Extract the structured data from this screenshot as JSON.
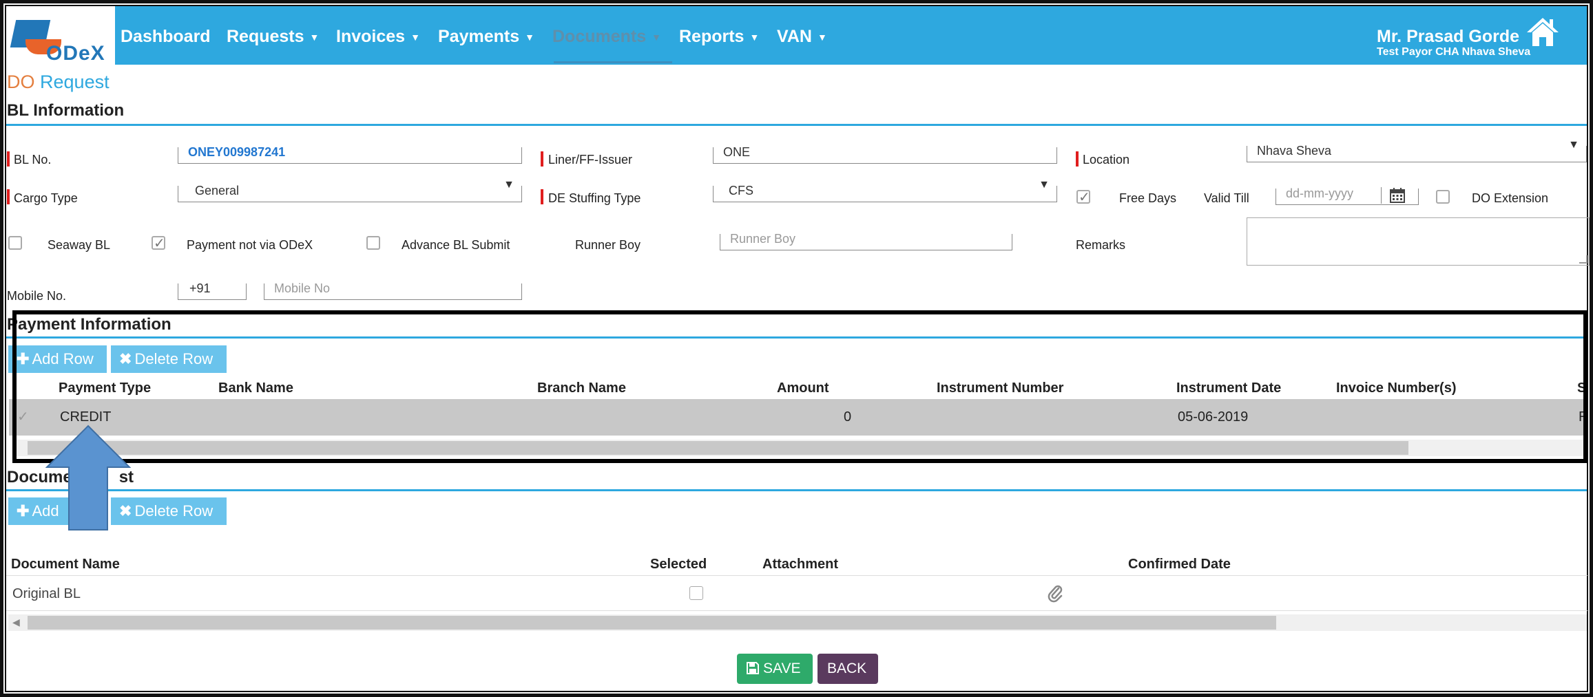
{
  "nav": {
    "logo": "ODeX",
    "items": [
      {
        "label": "Dashboard",
        "caret": false
      },
      {
        "label": "Requests",
        "caret": true
      },
      {
        "label": "Invoices",
        "caret": true
      },
      {
        "label": "Payments",
        "caret": true
      },
      {
        "label": "Documents",
        "caret": true
      },
      {
        "label": "Reports",
        "caret": true
      },
      {
        "label": "VAN",
        "caret": true
      }
    ],
    "user_name": "Mr. Prasad Gorde",
    "user_org": "Test Payor CHA Nhava Sheva"
  },
  "page": {
    "title_part1": "DO",
    "title_part2": "Request"
  },
  "bl_info": {
    "section_title": "BL Information",
    "bl_no_label": "BL No.",
    "bl_no_value": "ONEY009987241",
    "liner_label": "Liner/FF-Issuer",
    "liner_value": "ONE",
    "location_label": "Location",
    "location_value": "Nhava Sheva",
    "cargo_type_label": "Cargo Type",
    "cargo_type_value": "General",
    "de_stuffing_label": "DE Stuffing Type",
    "de_stuffing_value": "CFS",
    "free_days_label": "Free Days",
    "valid_till_label": "Valid Till",
    "valid_till_placeholder": "dd-mm-yyyy",
    "do_extension_label": "DO Extension",
    "seaway_bl_label": "Seaway BL",
    "payment_not_via_label": "Payment not via ODeX",
    "advance_bl_label": "Advance BL Submit",
    "runner_boy_label": "Runner Boy",
    "runner_boy_placeholder": "Runner Boy",
    "remarks_label": "Remarks",
    "mobile_label": "Mobile No.",
    "mobile_code": "+91",
    "mobile_placeholder": "Mobile No",
    "checks": {
      "free_days": true,
      "do_extension": false,
      "seaway_bl": false,
      "payment_not_via": true,
      "advance_bl": false
    }
  },
  "payment_info": {
    "section_title": "Payment Information",
    "add_row": "Add Row",
    "delete_row": "Delete Row",
    "columns": [
      "Payment Type",
      "Bank Name",
      "Branch Name",
      "Amount",
      "Instrument Number",
      "Instrument Date",
      "Invoice Number(s)",
      "St"
    ],
    "row": {
      "payment_type": "CREDIT",
      "bank_name": "",
      "branch_name": "",
      "amount": "0",
      "instrument_number": "",
      "instrument_date": "05-06-2019",
      "invoice_numbers": "",
      "status": "R"
    }
  },
  "document_list": {
    "section_title_part1": "Docume",
    "section_title_part2": "st",
    "add_row": "Add",
    "delete_row": "Delete Row",
    "columns": [
      "Document Name",
      "Selected",
      "Attachment",
      "Confirmed Date"
    ],
    "rows": [
      {
        "document_name": "Original BL",
        "selected": false,
        "confirmed_date": ""
      }
    ]
  },
  "actions": {
    "save": "SAVE",
    "back": "BACK"
  },
  "colors": {
    "nav_bg": "#2ea8df",
    "accent_orange": "#e47f3f",
    "save_green": "#2eaa6a",
    "back_purple": "#5a3a5e",
    "required_red": "#e01e1e"
  }
}
